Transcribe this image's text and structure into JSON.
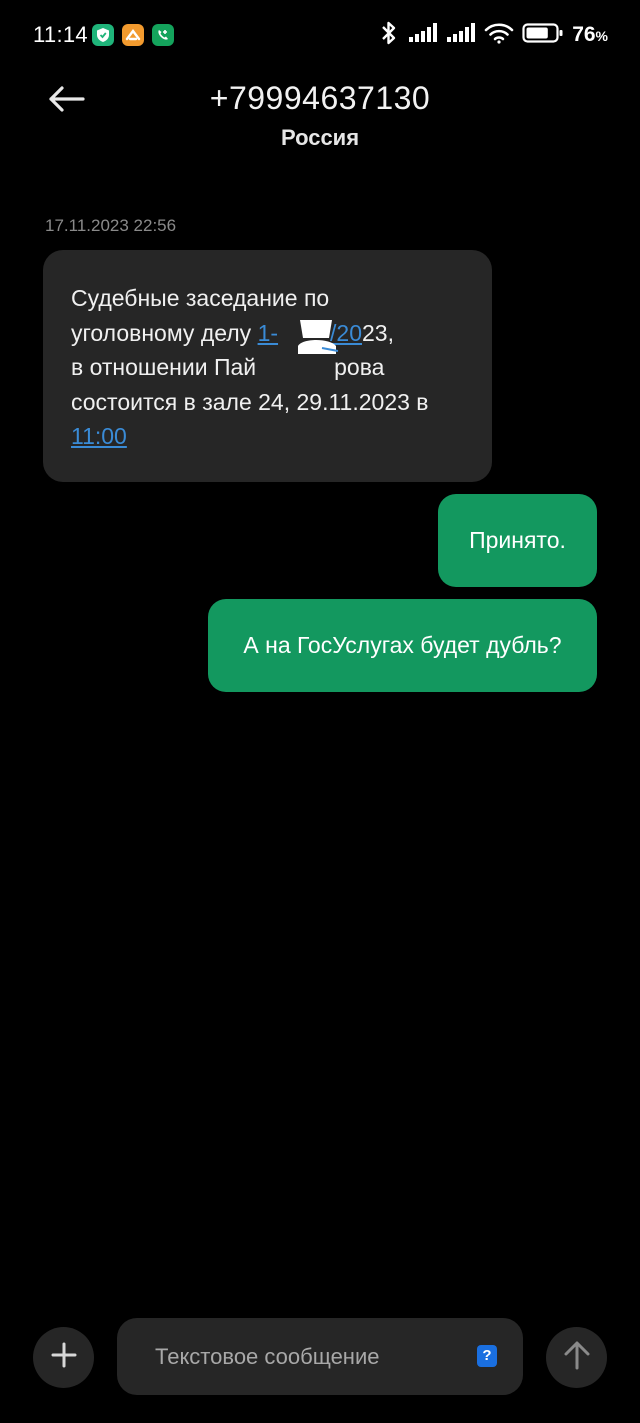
{
  "status_bar": {
    "time": "11:14",
    "battery_percent": "76",
    "battery_symbol": "%",
    "battery_level": 0.76,
    "icons": [
      "shield-app-icon",
      "orange-app-icon",
      "phone-app-icon",
      "bluetooth-icon",
      "signal-icon-1",
      "signal-icon-2",
      "wifi-icon",
      "battery-icon"
    ]
  },
  "header": {
    "phone_number": "+79994637130",
    "country": "Россия",
    "back_icon": "arrow-left-icon"
  },
  "conversation": {
    "timestamp": "17.11.2023 22:56",
    "incoming": {
      "line1": "Судебные заседание по",
      "line2_prefix": "уголовному делу ",
      "line2_link_a": "1-",
      "line2_link_b": "/20",
      "line2_suffix": "23,",
      "line3_prefix": "в отношении Пай",
      "line3_suffix": "рова",
      "line4": "состоится в зале 24, 29.11.2023 в",
      "line5_link": "11:00"
    },
    "outgoing": [
      {
        "text": "Принято."
      },
      {
        "text": "А на ГосУслугах будет дубль?"
      }
    ]
  },
  "composer": {
    "placeholder": "Текстовое сообщение",
    "help_badge": "?",
    "add_icon": "plus-icon",
    "send_icon": "arrow-up-icon"
  },
  "colors": {
    "background": "#000000",
    "incoming_bubble": "#262626",
    "outgoing_bubble": "#13985f",
    "link": "#3a8bd6",
    "accent_badge": "#1a6fe0"
  }
}
